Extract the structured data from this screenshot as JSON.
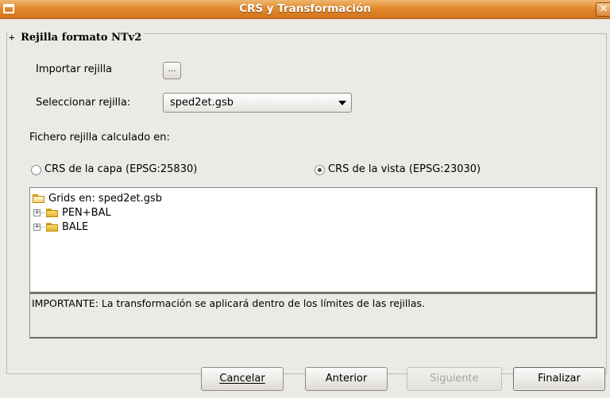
{
  "window": {
    "title": "CRS y Transformación",
    "close_glyph": "✕"
  },
  "group": {
    "collapse_glyph": "+",
    "title": "Rejilla formato NTv2"
  },
  "import_grid": {
    "label": "Importar rejilla",
    "button_label": "..."
  },
  "select_grid": {
    "label": "Seleccionar rejilla:",
    "value": "sped2et.gsb"
  },
  "computed_in": {
    "label": "Fichero rejilla calculado en:"
  },
  "radios": [
    {
      "label": "CRS de la capa (EPSG:25830)",
      "checked": false
    },
    {
      "label": "CRS de la vista (EPSG:23030)",
      "checked": true
    }
  ],
  "tree": {
    "root": "Grids en: sped2et.gsb",
    "children": [
      "PEN+BAL",
      "BALE"
    ]
  },
  "note": "IMPORTANTE: La transformación se aplicará dentro de los límites de las rejillas.",
  "buttons": {
    "cancel": "Cancelar",
    "previous": "Anterior",
    "next": "Siguiente",
    "finish": "Finalizar"
  }
}
